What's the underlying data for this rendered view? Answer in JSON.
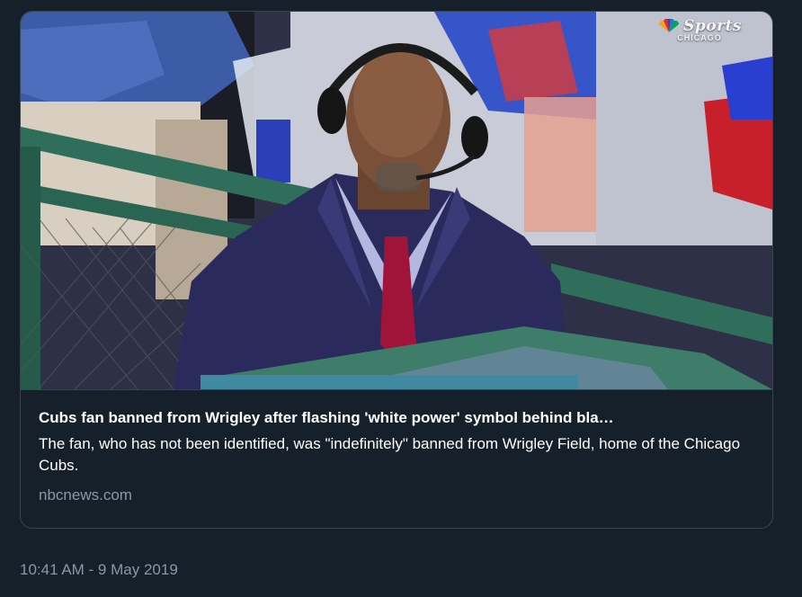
{
  "card": {
    "image_alt": "Broadcaster wearing headset seated in front of fans at Wrigley Field",
    "logo": {
      "brand": "Sports",
      "city": "CHICAGO",
      "icon": "peacock-icon"
    },
    "title": "Cubs fan banned from Wrigley after flashing 'white power' symbol behind bla…",
    "description": "The fan, who has not been identified, was \"indefinitely\" banned from Wrigley Field, home of the Chicago Cubs.",
    "domain": "nbcnews.com"
  },
  "tweet": {
    "timestamp": "10:41 AM - 9 May 2019"
  },
  "colors": {
    "background": "#15202b",
    "border": "#38444d",
    "text_primary": "#ffffff",
    "text_secondary": "#8899a6"
  }
}
